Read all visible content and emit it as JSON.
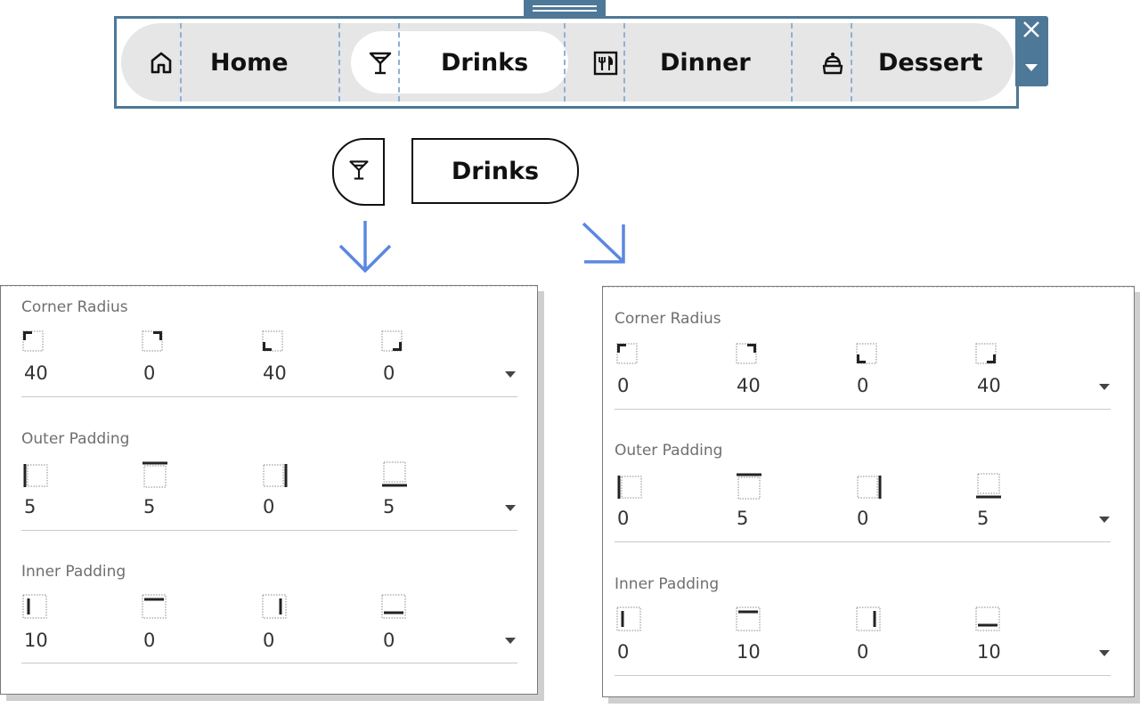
{
  "nav": {
    "items": [
      {
        "label": "Home",
        "icon": "home-icon",
        "active": false
      },
      {
        "label": "Drinks",
        "icon": "cocktail-icon",
        "active": true
      },
      {
        "label": "Dinner",
        "icon": "menu-card-icon",
        "active": false
      },
      {
        "label": "Dessert",
        "icon": "dessert-icon",
        "active": false
      }
    ],
    "accent_color": "#4e7897",
    "pill_color": "#e6e6e6"
  },
  "split_preview": {
    "label": "Drinks",
    "icon": "cocktail-icon"
  },
  "panel_left": {
    "corner_radius": {
      "title": "Corner Radius",
      "values": [
        "40",
        "0",
        "40",
        "0"
      ]
    },
    "outer_padding": {
      "title": "Outer Padding",
      "values": [
        "5",
        "5",
        "0",
        "5"
      ]
    },
    "inner_padding": {
      "title": "Inner Padding",
      "values": [
        "10",
        "0",
        "0",
        "0"
      ]
    }
  },
  "panel_right": {
    "corner_radius": {
      "title": "Corner Radius",
      "values": [
        "0",
        "40",
        "0",
        "40"
      ]
    },
    "outer_padding": {
      "title": "Outer Padding",
      "values": [
        "0",
        "5",
        "0",
        "5"
      ]
    },
    "inner_padding": {
      "title": "Inner Padding",
      "values": [
        "0",
        "10",
        "0",
        "10"
      ]
    }
  },
  "arrow_color": "#5b87e0"
}
